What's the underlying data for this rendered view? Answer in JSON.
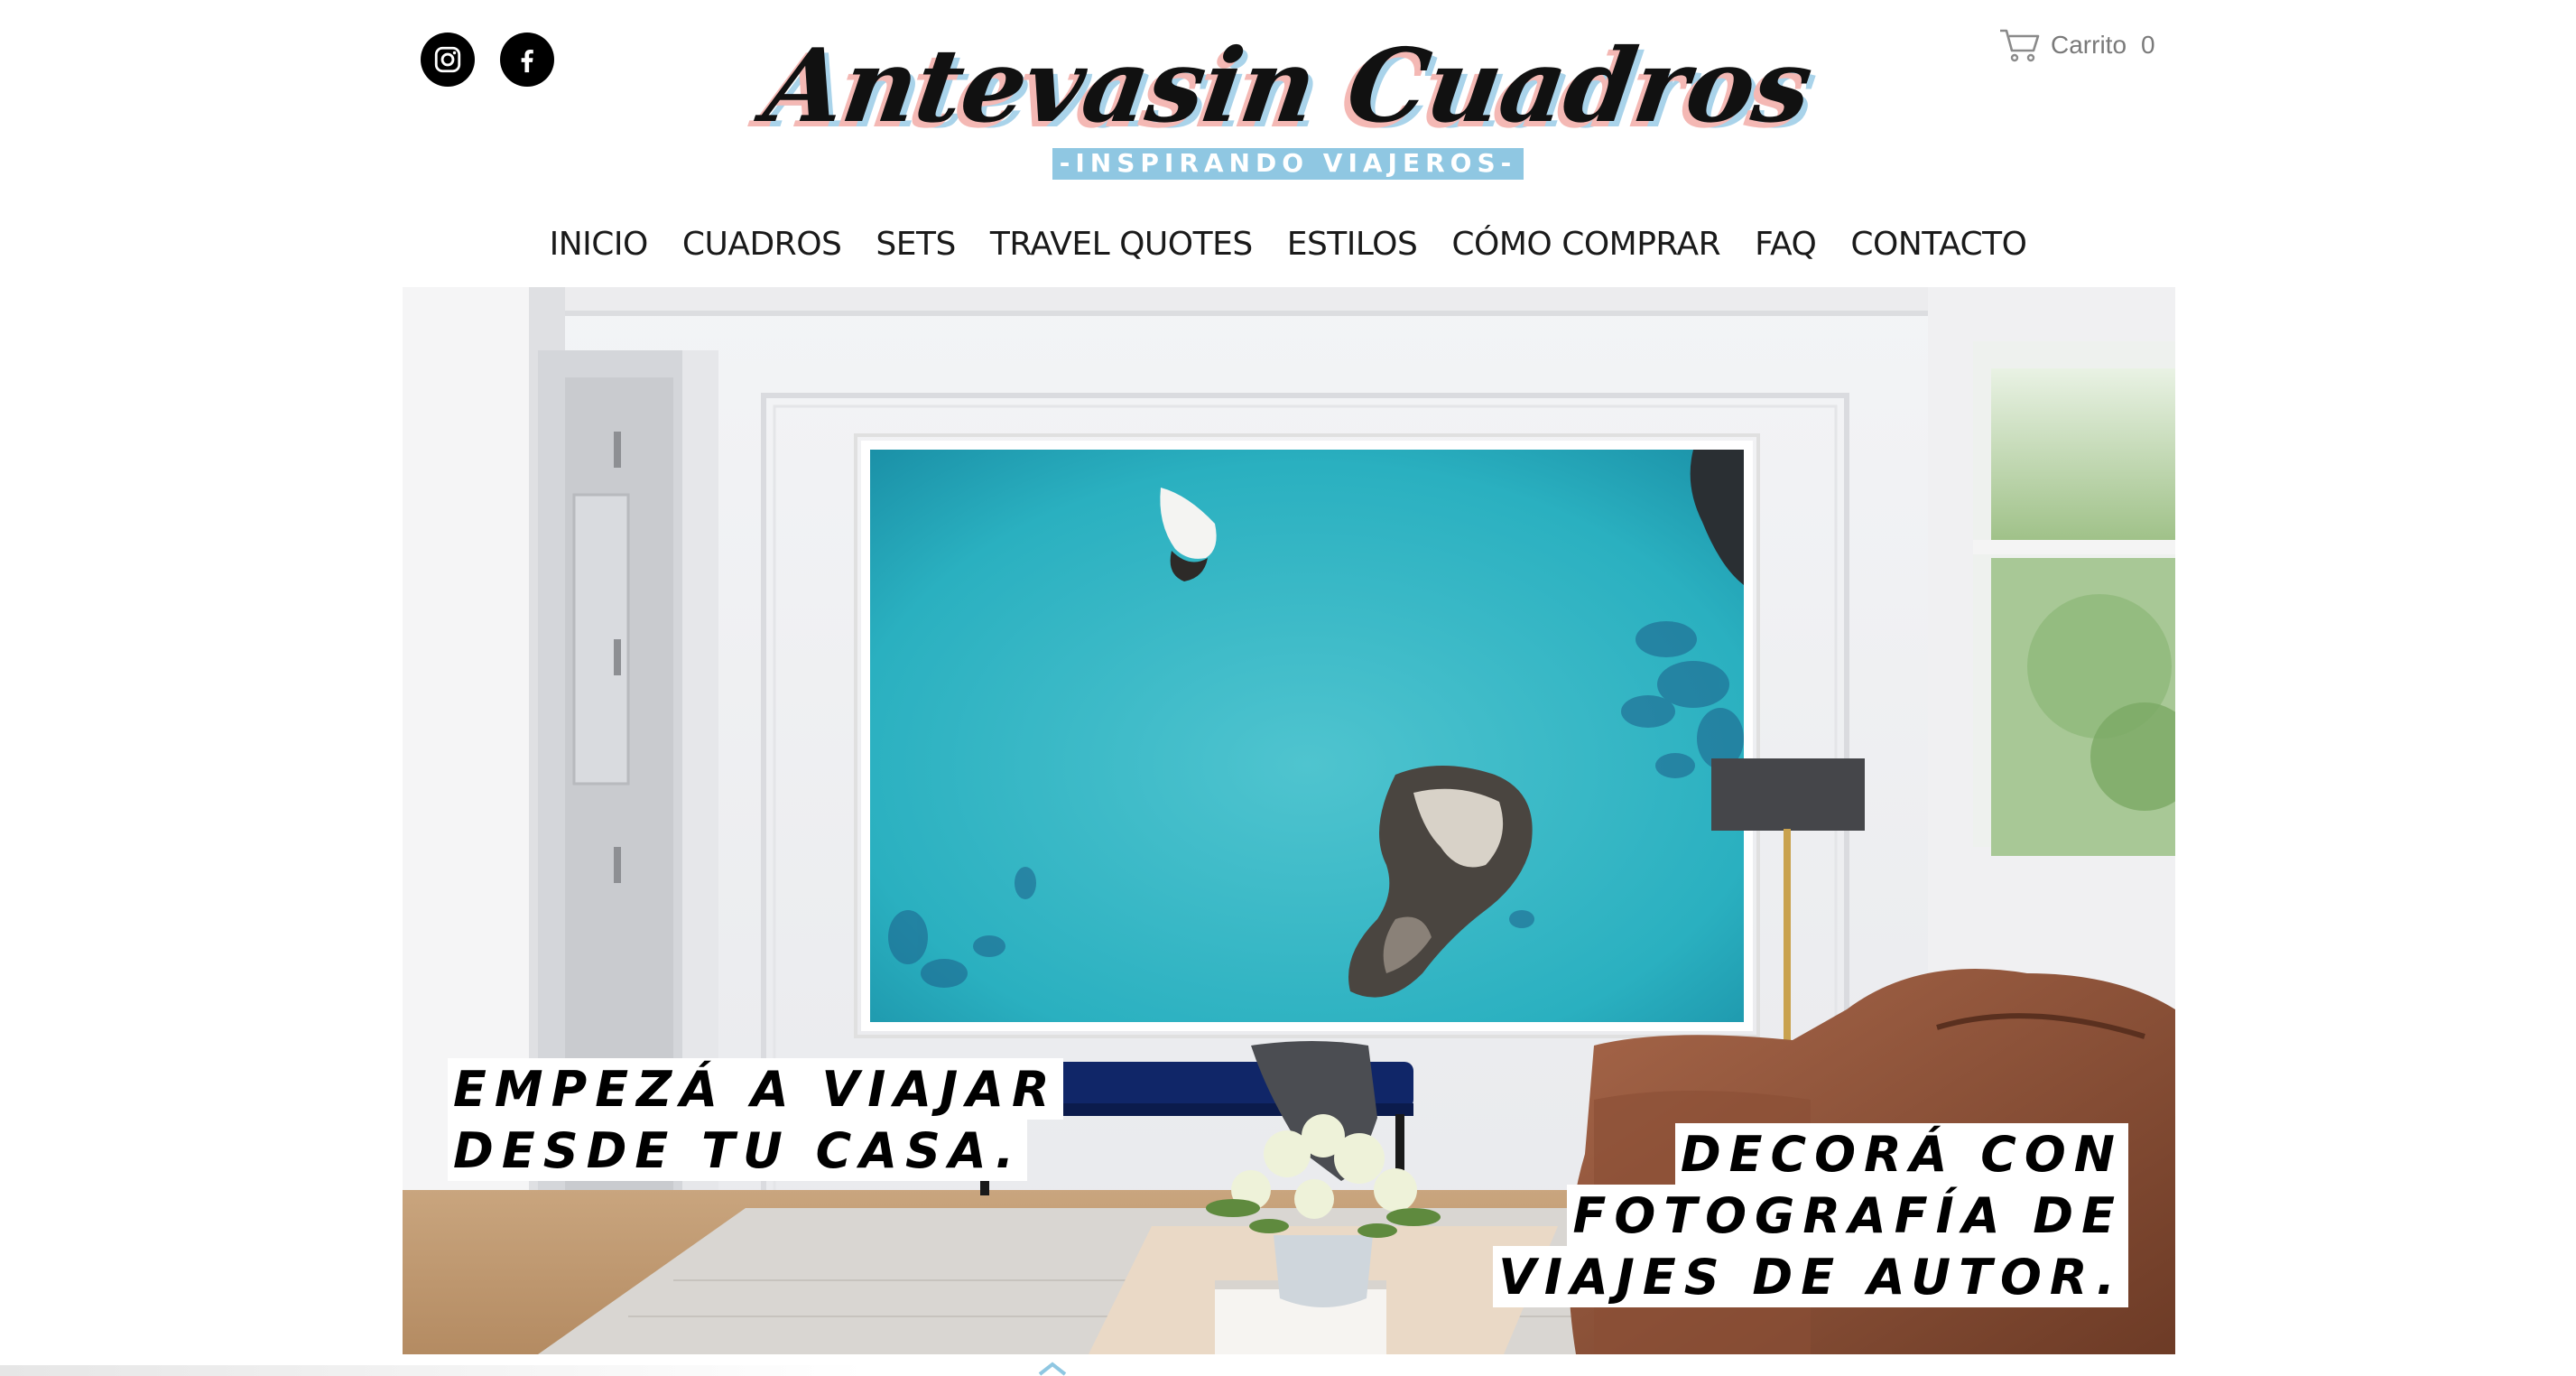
{
  "social": {
    "instagram_icon": "instagram-icon",
    "facebook_icon": "facebook-icon"
  },
  "cart": {
    "icon": "cart-icon",
    "label": "Carrito",
    "count": "0"
  },
  "brand": {
    "title": "Antevasin Cuadros",
    "tagline": "-INSPIRANDO VIAJEROS-",
    "accent_pink": "#f4b8b4",
    "accent_blue": "#8fc7e2"
  },
  "nav": {
    "items": [
      "INICIO",
      "CUADROS",
      "SETS",
      "TRAVEL QUOTES",
      "ESTILOS",
      "CÓMO COMPRAR",
      "FAQ",
      "CONTACTO"
    ]
  },
  "hero": {
    "caption_left": [
      "EMPEZÁ A VIAJAR",
      "DESDE TU CASA."
    ],
    "caption_right": [
      "DECORÁ CON",
      "FOTOGRAFÍA DE",
      "VIAJES DE AUTOR."
    ],
    "scroll_icon": "chevron-up-icon"
  }
}
